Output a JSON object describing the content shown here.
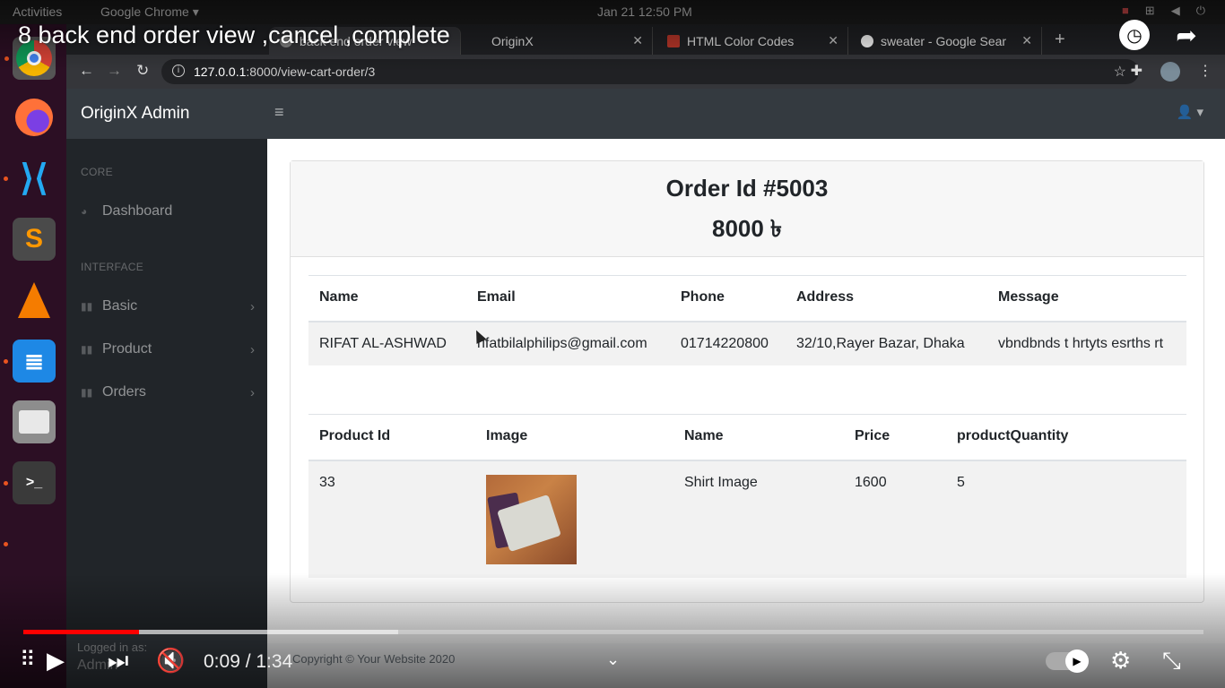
{
  "system": {
    "activities": "Activities",
    "app": "Google Chrome ▾",
    "clock": "Jan 21  12:50 PM"
  },
  "dock": {
    "apps": [
      {
        "icon": "chrome-icon",
        "glyph": "●",
        "color": "#4285f4"
      },
      {
        "icon": "firefox-icon",
        "glyph": "●",
        "color": "#ff7139"
      },
      {
        "icon": "vscode-icon",
        "glyph": "⟩",
        "color": "#007acc"
      },
      {
        "icon": "sublime-icon",
        "glyph": "S",
        "color": "#ff9800"
      },
      {
        "icon": "vlc-icon",
        "glyph": "▲",
        "color": "#f57c00"
      },
      {
        "icon": "writer-icon",
        "glyph": "≣",
        "color": "#1e88e5"
      },
      {
        "icon": "files-icon",
        "glyph": "▭",
        "color": "#9e9e9e"
      },
      {
        "icon": "terminal-icon",
        "glyph": ">_",
        "color": "#2b2b2b"
      }
    ]
  },
  "browser": {
    "tabs": [
      {
        "label": "back end order view",
        "active": true
      },
      {
        "label": "OriginX",
        "active": false
      },
      {
        "label": "HTML Color Codes",
        "active": false
      },
      {
        "label": "sweater - Google Sear",
        "active": false
      }
    ],
    "url_host": "127.0.0.1",
    "url_path": ":8000/view-cart-order/3"
  },
  "admin": {
    "brand": "OriginX Admin",
    "sidebar": {
      "core_heading": "CORE",
      "dashboard": "Dashboard",
      "interface_heading": "INTERFACE",
      "basic": "Basic",
      "product": "Product",
      "orders": "Orders"
    },
    "logged_in_label": "Logged in as:",
    "logged_in_user": "Admin",
    "footer": "Copyright © Your Website 2020"
  },
  "order": {
    "title": "Order Id #5003",
    "total": "8000 ৳",
    "customer_headers": [
      "Name",
      "Email",
      "Phone",
      "Address",
      "Message"
    ],
    "customer": {
      "name": "RIFAT AL-ASHWAD",
      "email": "rifatbilalphilips@gmail.com",
      "phone": "01714220800",
      "address": "32/10,Rayer Bazar, Dhaka",
      "message": "vbndbnds t hrtyts esrths rt"
    },
    "product_headers": [
      "Product Id",
      "Image",
      "Name",
      "Price",
      "productQuantity"
    ],
    "product": {
      "id": "33",
      "name": "Shirt Image",
      "price": "1600",
      "quantity": "5"
    }
  },
  "video": {
    "title": "8 back end order view ,cancel ,complete",
    "time": "0:09 / 1:34",
    "progress": 0.098,
    "buffered": 0.318
  }
}
